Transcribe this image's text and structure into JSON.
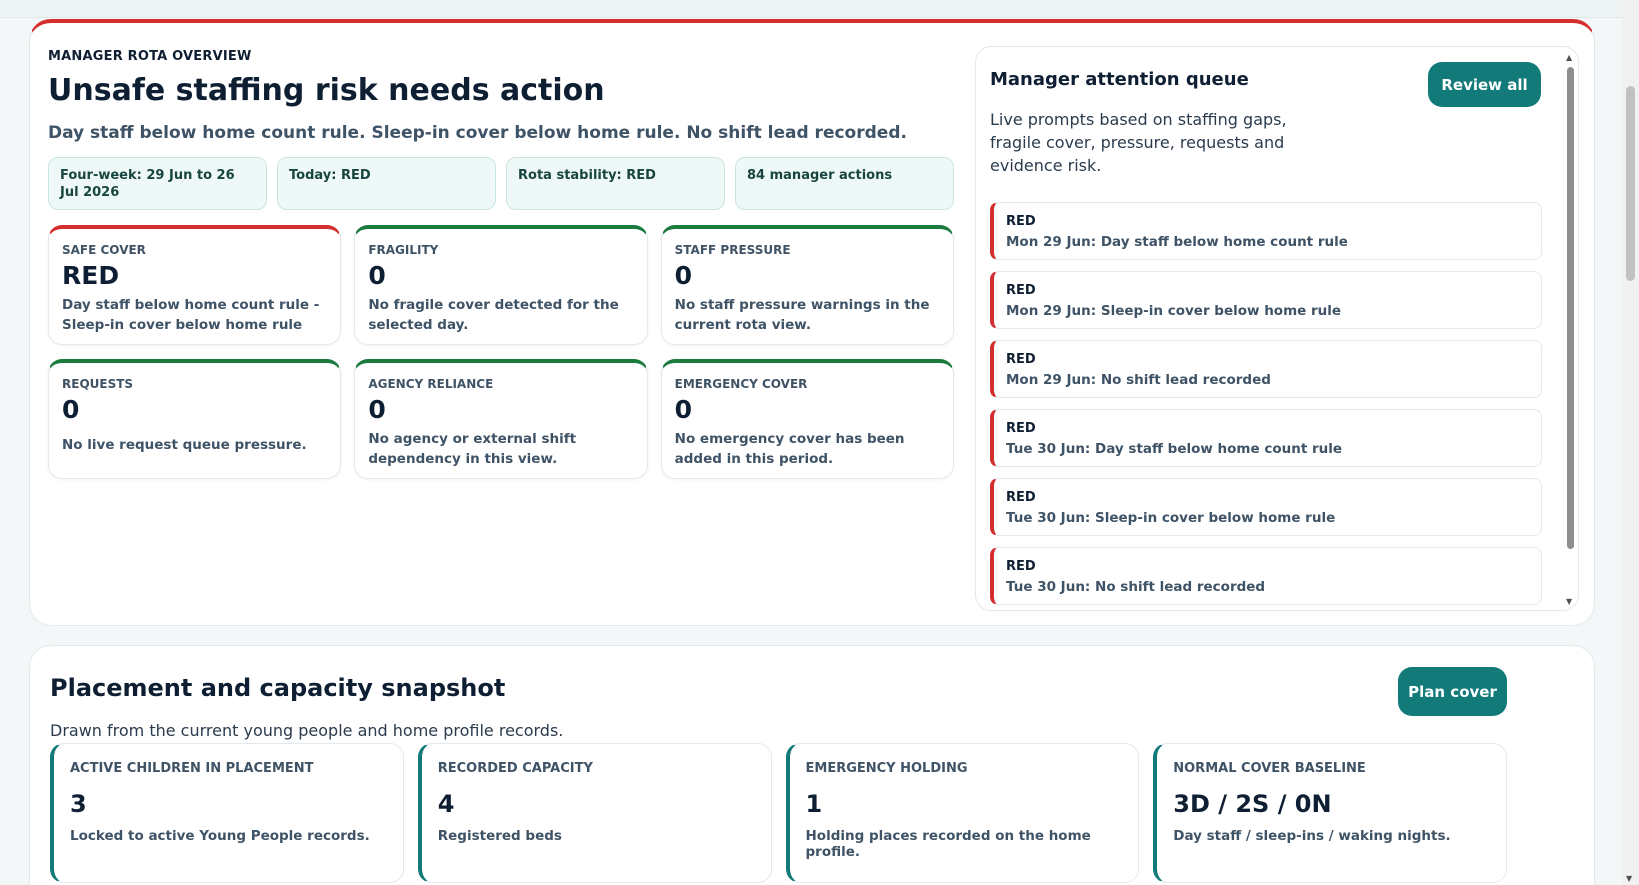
{
  "overview": {
    "eyebrow": "MANAGER ROTA OVERVIEW",
    "title": "Unsafe staffing risk needs action",
    "subtitle": "Day staff below home count rule. Sleep-in cover below home rule. No shift lead recorded.",
    "chips": [
      "Four-week: 29 Jun to 26 Jul 2026",
      "Today: RED",
      "Rota stability: RED",
      "84 manager actions"
    ],
    "metrics": [
      {
        "label": "SAFE COVER",
        "value": "RED",
        "desc": "Day staff below home count rule - Sleep-in cover below home rule",
        "status": "red"
      },
      {
        "label": "FRAGILITY",
        "value": "0",
        "desc": "No fragile cover detected for the selected day.",
        "status": "green"
      },
      {
        "label": "STAFF PRESSURE",
        "value": "0",
        "desc": "No staff pressure warnings in the current rota view.",
        "status": "green"
      },
      {
        "label": "REQUESTS",
        "value": "0",
        "desc": "No live request queue pressure.",
        "status": "green"
      },
      {
        "label": "AGENCY RELIANCE",
        "value": "0",
        "desc": "No agency or external shift dependency in this view.",
        "status": "green"
      },
      {
        "label": "EMERGENCY COVER",
        "value": "0",
        "desc": "No emergency cover has been added in this period.",
        "status": "green"
      }
    ]
  },
  "queue": {
    "title": "Manager attention queue",
    "description": "Live prompts based on staffing gaps, fragile cover, pressure, requests and evidence risk.",
    "review_label": "Review all",
    "items": [
      {
        "severity": "RED",
        "message": "Mon 29 Jun: Day staff below home count rule"
      },
      {
        "severity": "RED",
        "message": "Mon 29 Jun: Sleep-in cover below home rule"
      },
      {
        "severity": "RED",
        "message": "Mon 29 Jun: No shift lead recorded"
      },
      {
        "severity": "RED",
        "message": "Tue 30 Jun: Day staff below home count rule"
      },
      {
        "severity": "RED",
        "message": "Tue 30 Jun: Sleep-in cover below home rule"
      },
      {
        "severity": "RED",
        "message": "Tue 30 Jun: No shift lead recorded"
      }
    ]
  },
  "placement": {
    "title": "Placement and capacity snapshot",
    "description": "Drawn from the current young people and home profile records.",
    "plan_label": "Plan cover",
    "cards": [
      {
        "label": "ACTIVE CHILDREN IN PLACEMENT",
        "value": "3",
        "desc": "Locked to active Young People records."
      },
      {
        "label": "RECORDED CAPACITY",
        "value": "4",
        "desc": "Registered beds"
      },
      {
        "label": "EMERGENCY HOLDING",
        "value": "1",
        "desc": "Holding places recorded on the home profile."
      },
      {
        "label": "NORMAL COVER BASELINE",
        "value": "3D / 2S / 0N",
        "desc": "Day staff / sleep-ins / waking nights."
      }
    ]
  },
  "colors": {
    "accent": "#137a7a",
    "red": "#d32f2f",
    "green": "#1b7a3e",
    "ink": "#0f1f33"
  }
}
